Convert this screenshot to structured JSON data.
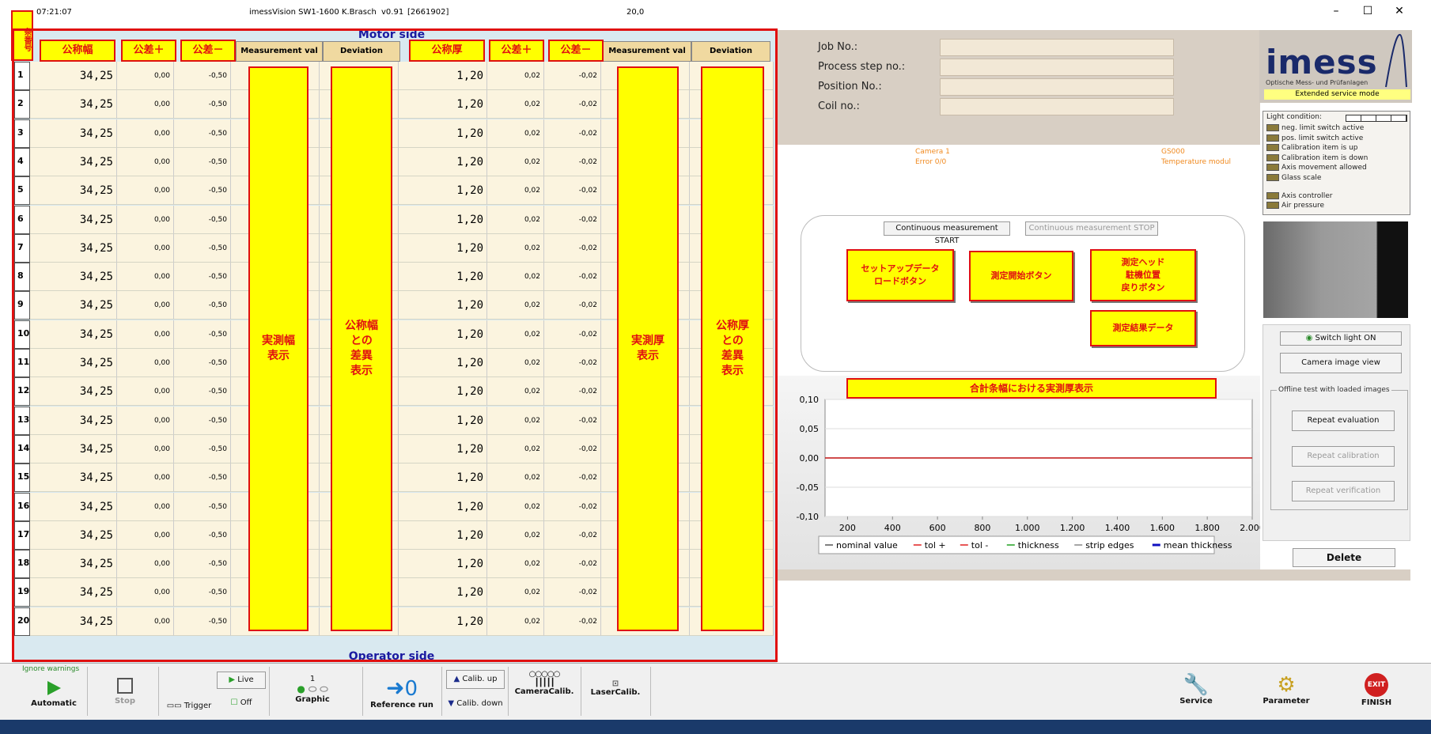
{
  "titlebar": {
    "time": "07:21:07",
    "app": "imessVision SW1-1600 K.Brasch",
    "version": "v0.91",
    "build": "[2661902]",
    "value": "20,0"
  },
  "window": {
    "minimize": "–",
    "maximize": "☐",
    "close": "✕"
  },
  "table": {
    "motor_side": "Motor side",
    "operator_side": "Operator side",
    "col_rownum": "条番号",
    "col_nominal_width": "公称幅",
    "col_tol_plus_1": "公差＋",
    "col_tol_minus_1": "公差－",
    "col_meas_1": "Measurement val",
    "col_dev_1": "Deviation",
    "col_nominal_thick": "公称厚",
    "col_tol_plus_2": "公差＋",
    "col_tol_minus_2": "公差－",
    "col_meas_2": "Measurement val",
    "col_dev_2": "Deviation",
    "yellow_meas_width": "実測幅\n表示",
    "yellow_dev_width": "公称幅\nとの\n差異\n表示",
    "yellow_meas_thick": "実測厚\n表示",
    "yellow_dev_thick": "公称厚\nとの\n差異\n表示",
    "rows": [
      {
        "n": "1",
        "w": "34,25",
        "wp": "0,00",
        "wm": "-0,50",
        "t": "1,20",
        "tp": "0,02",
        "tm": "-0,02"
      },
      {
        "n": "2",
        "w": "34,25",
        "wp": "0,00",
        "wm": "-0,50",
        "t": "1,20",
        "tp": "0,02",
        "tm": "-0,02"
      },
      {
        "n": "3",
        "w": "34,25",
        "wp": "0,00",
        "wm": "-0,50",
        "t": "1,20",
        "tp": "0,02",
        "tm": "-0,02"
      },
      {
        "n": "4",
        "w": "34,25",
        "wp": "0,00",
        "wm": "-0,50",
        "t": "1,20",
        "tp": "0,02",
        "tm": "-0,02"
      },
      {
        "n": "5",
        "w": "34,25",
        "wp": "0,00",
        "wm": "-0,50",
        "t": "1,20",
        "tp": "0,02",
        "tm": "-0,02"
      },
      {
        "n": "6",
        "w": "34,25",
        "wp": "0,00",
        "wm": "-0,50",
        "t": "1,20",
        "tp": "0,02",
        "tm": "-0,02"
      },
      {
        "n": "7",
        "w": "34,25",
        "wp": "0,00",
        "wm": "-0,50",
        "t": "1,20",
        "tp": "0,02",
        "tm": "-0,02"
      },
      {
        "n": "8",
        "w": "34,25",
        "wp": "0,00",
        "wm": "-0,50",
        "t": "1,20",
        "tp": "0,02",
        "tm": "-0,02"
      },
      {
        "n": "9",
        "w": "34,25",
        "wp": "0,00",
        "wm": "-0,50",
        "t": "1,20",
        "tp": "0,02",
        "tm": "-0,02"
      },
      {
        "n": "10",
        "w": "34,25",
        "wp": "0,00",
        "wm": "-0,50",
        "t": "1,20",
        "tp": "0,02",
        "tm": "-0,02"
      },
      {
        "n": "11",
        "w": "34,25",
        "wp": "0,00",
        "wm": "-0,50",
        "t": "1,20",
        "tp": "0,02",
        "tm": "-0,02"
      },
      {
        "n": "12",
        "w": "34,25",
        "wp": "0,00",
        "wm": "-0,50",
        "t": "1,20",
        "tp": "0,02",
        "tm": "-0,02"
      },
      {
        "n": "13",
        "w": "34,25",
        "wp": "0,00",
        "wm": "-0,50",
        "t": "1,20",
        "tp": "0,02",
        "tm": "-0,02"
      },
      {
        "n": "14",
        "w": "34,25",
        "wp": "0,00",
        "wm": "-0,50",
        "t": "1,20",
        "tp": "0,02",
        "tm": "-0,02"
      },
      {
        "n": "15",
        "w": "34,25",
        "wp": "0,00",
        "wm": "-0,50",
        "t": "1,20",
        "tp": "0,02",
        "tm": "-0,02"
      },
      {
        "n": "16",
        "w": "34,25",
        "wp": "0,00",
        "wm": "-0,50",
        "t": "1,20",
        "tp": "0,02",
        "tm": "-0,02"
      },
      {
        "n": "17",
        "w": "34,25",
        "wp": "0,00",
        "wm": "-0,50",
        "t": "1,20",
        "tp": "0,02",
        "tm": "-0,02"
      },
      {
        "n": "18",
        "w": "34,25",
        "wp": "0,00",
        "wm": "-0,50",
        "t": "1,20",
        "tp": "0,02",
        "tm": "-0,02"
      },
      {
        "n": "19",
        "w": "34,25",
        "wp": "0,00",
        "wm": "-0,50",
        "t": "1,20",
        "tp": "0,02",
        "tm": "-0,02"
      },
      {
        "n": "20",
        "w": "34,25",
        "wp": "0,00",
        "wm": "-0,50",
        "t": "1,20",
        "tp": "0,02",
        "tm": "-0,02"
      }
    ]
  },
  "form": {
    "job_no": "Job No.:",
    "process_step": "Process step no.:",
    "position_no": "Position No.:",
    "coil_no": "Coil no.:"
  },
  "orange": {
    "camera": "Camera 1",
    "error": "Error 0/0",
    "gs": "GS000",
    "temp": "Temperature modul"
  },
  "logo": {
    "name": "imess",
    "subtitle": "Optische Mess- und Prüfanlagen",
    "mode": "Extended service mode"
  },
  "status": {
    "light_condition": "Light condition:",
    "items": [
      "neg. limit switch active",
      "pos. limit switch active",
      "Calibration item is up",
      "Calibration item is down",
      "Axis movement allowed",
      "Glass scale"
    ],
    "axis_controller": "Axis controller",
    "air_pressure": "Air pressure"
  },
  "right_buttons": {
    "switch_light": "Switch light ON",
    "camera_view": "Camera image view",
    "offline_group": "Offline test with loaded images",
    "repeat_eval": "Repeat evaluation",
    "repeat_calib": "Repeat calibration",
    "repeat_verif": "Repeat verification",
    "delete_notif": "Delete notifications"
  },
  "ctrl": {
    "start": "Continuous measurement START",
    "stop": "Continuous measurement STOP",
    "setup_load": "セットアップデータ\nロードボタン",
    "measure_start": "測定開始ボタン",
    "head_return": "測定ヘッド\n駐機位置\n戻りボタン",
    "result_data": "測定結果データ"
  },
  "chart_data": {
    "type": "line",
    "title": "合計条幅における実測厚表示",
    "x_ticks": [
      "200",
      "400",
      "600",
      "800",
      "1.000",
      "1.200",
      "1.400",
      "1.600",
      "1.800",
      "2.000"
    ],
    "y_ticks": [
      "0,10",
      "0,05",
      "0,00",
      "-0,05",
      "-0,10"
    ],
    "ylim": [
      -0.1,
      0.1
    ],
    "xlim": [
      100,
      2000
    ],
    "series": [
      {
        "name": "nominal value",
        "color": "#555555",
        "values": []
      },
      {
        "name": "tol +",
        "color": "#e02020",
        "values": []
      },
      {
        "name": "tol -",
        "color": "#e02020",
        "values": []
      },
      {
        "name": "thickness",
        "color": "#20a020",
        "values": []
      },
      {
        "name": "strip edges",
        "color": "#888888",
        "values": []
      },
      {
        "name": "mean thickness",
        "color": "#1010c0",
        "values": []
      }
    ],
    "reference_line": {
      "y": 0.0,
      "color": "#c01010"
    },
    "legend": "bottom"
  },
  "toolbar": {
    "ignore_warnings": "Ignore warnings",
    "automatic": "Automatic",
    "stop": "Stop",
    "trigger": "Trigger",
    "live": "Live",
    "off": "Off",
    "graphic_count": "1",
    "graphic": "Graphic",
    "reference_run": "Reference run",
    "ref_count": "0",
    "calib_up": "Calib. up",
    "calib_down": "Calib. down",
    "camera_calib": "CameraCalib.",
    "laser_calib": "LaserCalib.",
    "service": "Service",
    "parameter": "Parameter",
    "finish": "FINISH",
    "exit": "EXIT"
  }
}
